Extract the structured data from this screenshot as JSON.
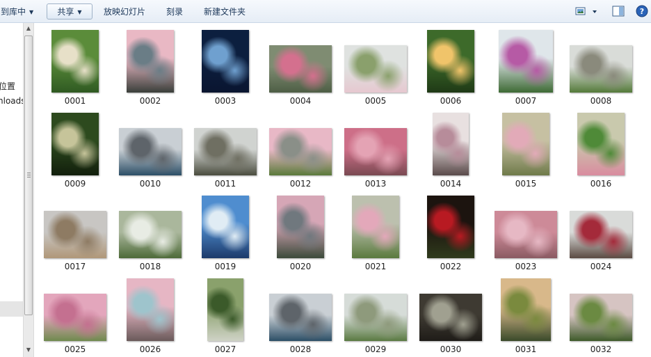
{
  "toolbar": {
    "include_library": "到库中",
    "share": "共享",
    "slideshow": "放映幻灯片",
    "burn": "刻录",
    "new_folder": "新建文件夹",
    "view_icon": "view-thumbnails-icon",
    "pane_icon": "preview-pane-icon",
    "help_icon": "help-icon"
  },
  "nav": {
    "items": [
      "位置",
      "nloads"
    ]
  },
  "colors": {
    "toolbar_text": "#1e395b",
    "selection": "#e5e5e5"
  },
  "files": [
    {
      "name": "0001",
      "orient": "portrait",
      "colors": [
        "#5b8c3a",
        "#e7e0c8",
        "#2f5a22"
      ]
    },
    {
      "name": "0002",
      "orient": "portrait",
      "colors": [
        "#e9b8c4",
        "#6a7d86",
        "#3a3f3a"
      ]
    },
    {
      "name": "0003",
      "orient": "portrait",
      "colors": [
        "#0c1f3f",
        "#6fa0cf",
        "#0a1530"
      ]
    },
    {
      "name": "0004",
      "orient": "landscape",
      "colors": [
        "#7f8c72",
        "#d4708e",
        "#4e5e45"
      ]
    },
    {
      "name": "0005",
      "orient": "landscape",
      "colors": [
        "#dfe2e0",
        "#8aa06c",
        "#e6c8d0"
      ]
    },
    {
      "name": "0006",
      "orient": "portrait",
      "colors": [
        "#3d6a2a",
        "#f0c46a",
        "#1f3a16"
      ]
    },
    {
      "name": "0007",
      "orient": "landscape43",
      "colors": [
        "#dfe6ea",
        "#b65aa5",
        "#3e6a35"
      ]
    },
    {
      "name": "0008",
      "orient": "landscape",
      "colors": [
        "#d9dcd8",
        "#8a8a7c",
        "#547a3a"
      ]
    },
    {
      "name": "0009",
      "orient": "portrait",
      "colors": [
        "#2d4a1e",
        "#c6c49a",
        "#121f0c"
      ]
    },
    {
      "name": "0010",
      "orient": "landscape",
      "colors": [
        "#c9cfd4",
        "#5e646a",
        "#2c4e66"
      ]
    },
    {
      "name": "0011",
      "orient": "landscape",
      "colors": [
        "#d0d3d0",
        "#6f6f62",
        "#4a4c3e"
      ]
    },
    {
      "name": "0012",
      "orient": "landscape",
      "colors": [
        "#e8b8c6",
        "#8a8f88",
        "#5a7a3a"
      ]
    },
    {
      "name": "0013",
      "orient": "landscape",
      "colors": [
        "#cd6f88",
        "#e4a3b4",
        "#7a4a52"
      ]
    },
    {
      "name": "0014",
      "orient": "tall",
      "colors": [
        "#e8e0e0",
        "#b78c9a",
        "#5a4a4a"
      ]
    },
    {
      "name": "0015",
      "orient": "portrait",
      "colors": [
        "#c6c0a2",
        "#e2aab8",
        "#6f7a4a"
      ]
    },
    {
      "name": "0016",
      "orient": "portrait",
      "colors": [
        "#c9c9ad",
        "#4f8a38",
        "#d98c9f"
      ]
    },
    {
      "name": "0017",
      "orient": "landscape",
      "colors": [
        "#c8c6c3",
        "#8e7b63",
        "#b09778"
      ]
    },
    {
      "name": "0018",
      "orient": "landscape",
      "colors": [
        "#aab79c",
        "#e8ece4",
        "#4d6a38"
      ]
    },
    {
      "name": "0019",
      "orient": "portrait",
      "colors": [
        "#4f8dcf",
        "#e0ecf4",
        "#1c3a6a"
      ]
    },
    {
      "name": "0020",
      "orient": "portrait",
      "colors": [
        "#d6a6b6",
        "#70787e",
        "#3b4a3a"
      ]
    },
    {
      "name": "0021",
      "orient": "portrait",
      "colors": [
        "#bcc0ae",
        "#e3a8ba",
        "#5a7a3e"
      ]
    },
    {
      "name": "0022",
      "orient": "portrait",
      "colors": [
        "#1c140f",
        "#b81a22",
        "#2f3a1c"
      ]
    },
    {
      "name": "0023",
      "orient": "landscape",
      "colors": [
        "#cd8a98",
        "#e6b8c4",
        "#8a5a62"
      ]
    },
    {
      "name": "0024",
      "orient": "landscape",
      "colors": [
        "#d9dbd9",
        "#a42a3a",
        "#5a4a42"
      ]
    },
    {
      "name": "0025",
      "orient": "landscape",
      "colors": [
        "#e3a6bc",
        "#c47090",
        "#6f8a4e"
      ]
    },
    {
      "name": "0026",
      "orient": "portrait",
      "colors": [
        "#e6b6c4",
        "#9ec4cc",
        "#6a5a5a"
      ]
    },
    {
      "name": "0027",
      "orient": "tall",
      "colors": [
        "#8aa16c",
        "#3b5a2a",
        "#cfd2c6"
      ]
    },
    {
      "name": "0028",
      "orient": "landscape",
      "colors": [
        "#c9cfd4",
        "#5e646a",
        "#2c4e66"
      ]
    },
    {
      "name": "0029",
      "orient": "landscape",
      "colors": [
        "#d6dcd8",
        "#8e9a7c",
        "#5a7a42"
      ]
    },
    {
      "name": "0030",
      "orient": "landscape",
      "colors": [
        "#3e3a32",
        "#a0a090",
        "#1f1c18"
      ]
    },
    {
      "name": "0031",
      "orient": "portrait43",
      "colors": [
        "#d8b88a",
        "#7a8a3e",
        "#3a4a2a"
      ]
    },
    {
      "name": "0032",
      "orient": "landscape",
      "colors": [
        "#d6c4c2",
        "#6b8a42",
        "#3e5a2a"
      ]
    }
  ]
}
